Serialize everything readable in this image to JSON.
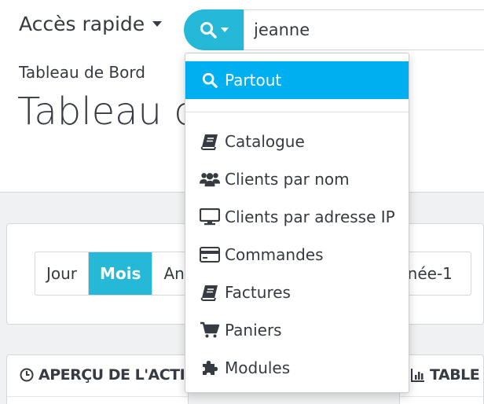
{
  "header": {
    "quick_access_label": "Accès rapide",
    "search": {
      "value": "jeanne"
    },
    "breadcrumb": "Tableau de Bord",
    "page_title": "Tableau de Bord"
  },
  "period_buttons": [
    {
      "label": "Jour",
      "active": false
    },
    {
      "label": "Mois",
      "active": true
    },
    {
      "label": "An",
      "active": false
    }
  ],
  "period_right_label": "nnée-1",
  "search_dropdown": {
    "items": [
      {
        "label": "Partout",
        "icon": "search-icon",
        "active": true
      },
      {
        "label": "Catalogue",
        "icon": "book-icon"
      },
      {
        "label": "Clients par nom",
        "icon": "users-icon"
      },
      {
        "label": "Clients par adresse IP",
        "icon": "desktop-icon"
      },
      {
        "label": "Commandes",
        "icon": "credit-card-icon"
      },
      {
        "label": "Factures",
        "icon": "book-icon"
      },
      {
        "label": "Paniers",
        "icon": "cart-icon"
      },
      {
        "label": "Modules",
        "icon": "puzzle-icon"
      }
    ]
  },
  "panels": {
    "activity_heading": "APERÇU DE L'ACTIVI",
    "table_heading": "TABLE"
  },
  "colors": {
    "accent": "#25b9d7",
    "dropdown_active": "#00aff0",
    "text": "#363a41"
  }
}
